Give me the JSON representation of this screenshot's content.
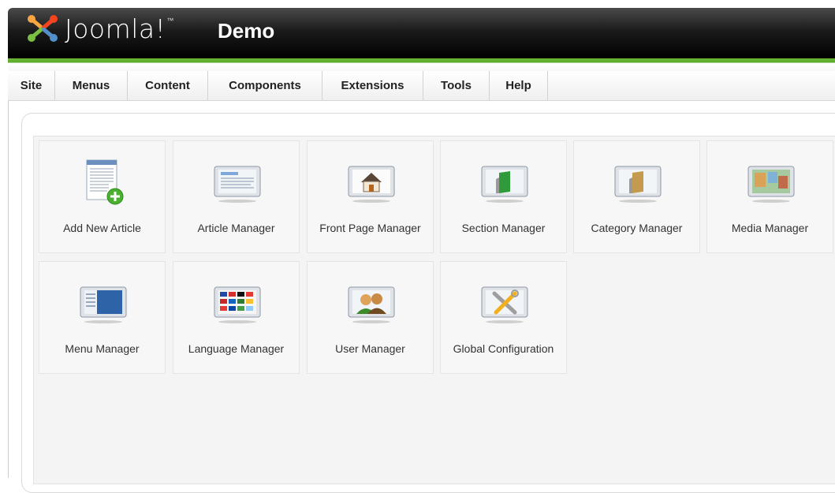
{
  "header": {
    "logo_text": "Joomla!",
    "logo_tm": "™",
    "site_title": "Demo"
  },
  "menu": [
    {
      "label": "Site"
    },
    {
      "label": "Menus"
    },
    {
      "label": "Content"
    },
    {
      "label": "Components"
    },
    {
      "label": "Extensions"
    },
    {
      "label": "Tools"
    },
    {
      "label": "Help"
    }
  ],
  "cpanel": {
    "tiles": [
      {
        "label": "Add New Article",
        "icon": "add-article-icon"
      },
      {
        "label": "Article Manager",
        "icon": "article-manager-icon"
      },
      {
        "label": "Front Page Manager",
        "icon": "house-icon"
      },
      {
        "label": "Section Manager",
        "icon": "green-folder-icon"
      },
      {
        "label": "Category Manager",
        "icon": "brown-folder-icon"
      },
      {
        "label": "Media Manager",
        "icon": "media-icon"
      },
      {
        "label": "Menu Manager",
        "icon": "menu-icon"
      },
      {
        "label": "Language Manager",
        "icon": "flags-icon"
      },
      {
        "label": "User Manager",
        "icon": "users-icon"
      },
      {
        "label": "Global Configuration",
        "icon": "tools-icon"
      }
    ]
  },
  "colors": {
    "brand_green": "#5aa72a",
    "header_black": "#000000"
  }
}
